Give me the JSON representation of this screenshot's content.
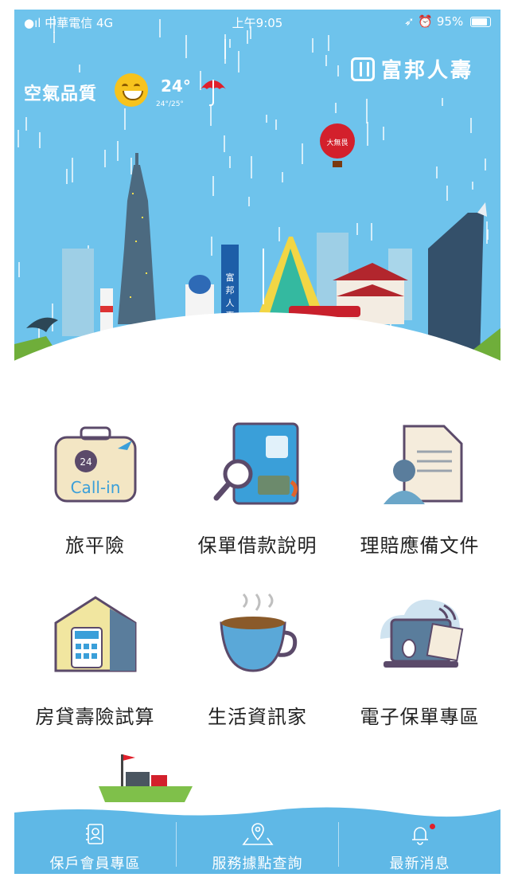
{
  "status_bar": {
    "carrier": "中華電信",
    "network": "4G",
    "time": "上午9:05",
    "battery": "95%"
  },
  "brand": {
    "name": "富邦人壽",
    "logo": "fubon-logo-icon"
  },
  "weather": {
    "air_quality_label": "空氣品質",
    "air_quality_icon": "smiley-face-icon",
    "temperature": "24°",
    "temp_range": "24°/25°",
    "condition_icon": "umbrella-icon"
  },
  "illustration": {
    "balloon_label": "大無畏",
    "sign_text": "富邦人壽"
  },
  "services": [
    {
      "label": "旅平險",
      "icon": "travel-suitcase-icon",
      "badge": "24",
      "badge_text": "Call-in"
    },
    {
      "label": "保單借款說明",
      "icon": "policy-loan-icon"
    },
    {
      "label": "理賠應備文件",
      "icon": "claim-document-icon"
    },
    {
      "label": "房貸壽險試算",
      "icon": "mortgage-calculator-house-icon"
    },
    {
      "label": "生活資訊家",
      "icon": "coffee-cup-icon"
    },
    {
      "label": "電子保單專區",
      "icon": "e-policy-laptop-icon"
    }
  ],
  "tab_bar": {
    "tabs": [
      {
        "label": "保戶會員專區",
        "icon": "member-card-icon"
      },
      {
        "label": "服務據點查詢",
        "icon": "location-pin-icon"
      },
      {
        "label": "最新消息",
        "icon": "bell-icon",
        "has_notification": true
      }
    ]
  },
  "colors": {
    "sky": "#6ec3ec",
    "tab_bar": "#5fb8e6",
    "text_dark": "#222222",
    "notification": "#e0202c"
  }
}
